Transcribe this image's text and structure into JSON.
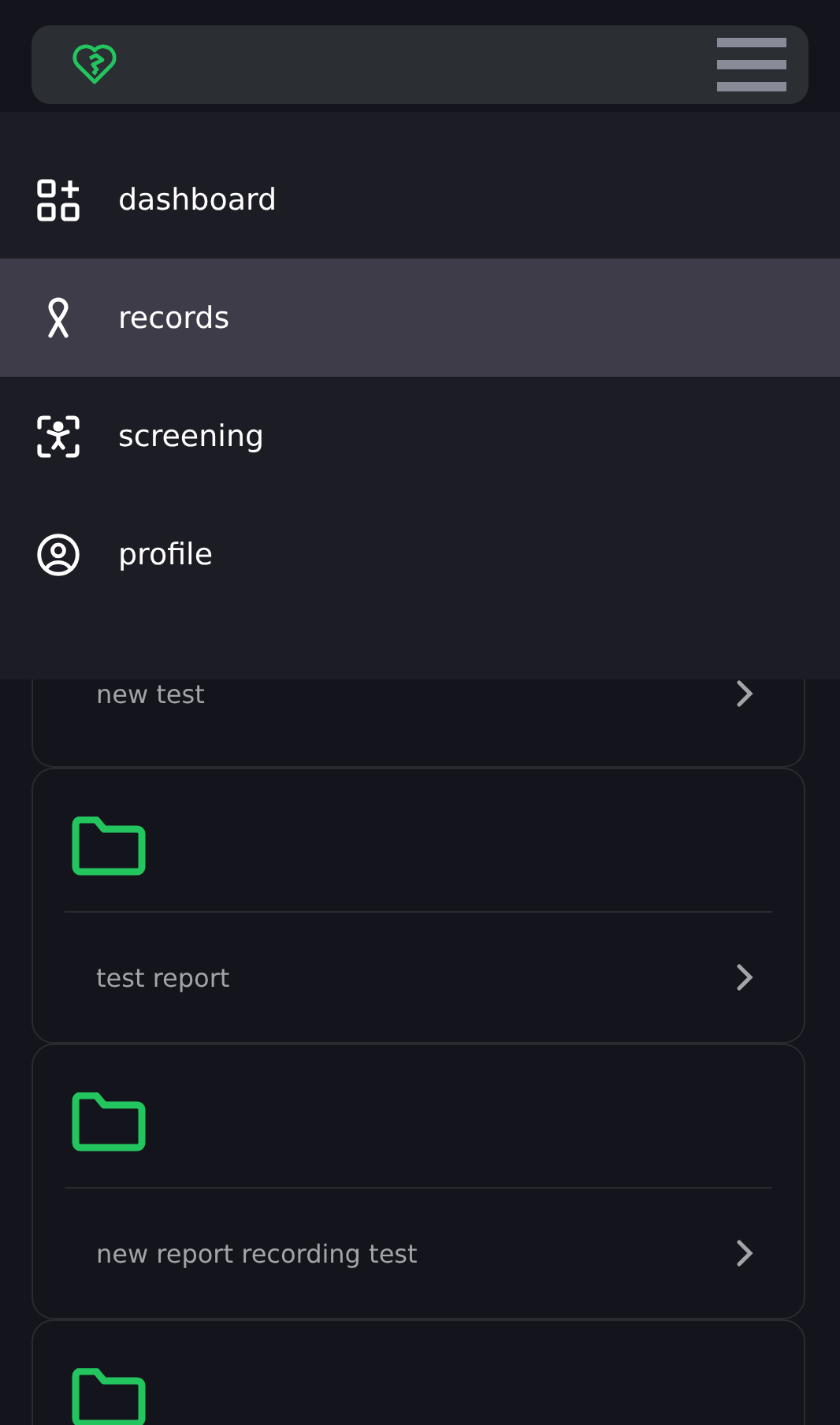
{
  "menu": {
    "items": [
      {
        "label": "dashboard",
        "kind": "dashboard",
        "selected": false
      },
      {
        "label": "records",
        "kind": "ribbon",
        "selected": true
      },
      {
        "label": "screening",
        "kind": "screening",
        "selected": false
      },
      {
        "label": "profile",
        "kind": "profile",
        "selected": false
      }
    ]
  },
  "records": [
    {
      "kind": "partial",
      "label": "new test"
    },
    {
      "kind": "full",
      "label": "test report"
    },
    {
      "kind": "full",
      "label": "new report recording test"
    },
    {
      "kind": "cut"
    }
  ]
}
